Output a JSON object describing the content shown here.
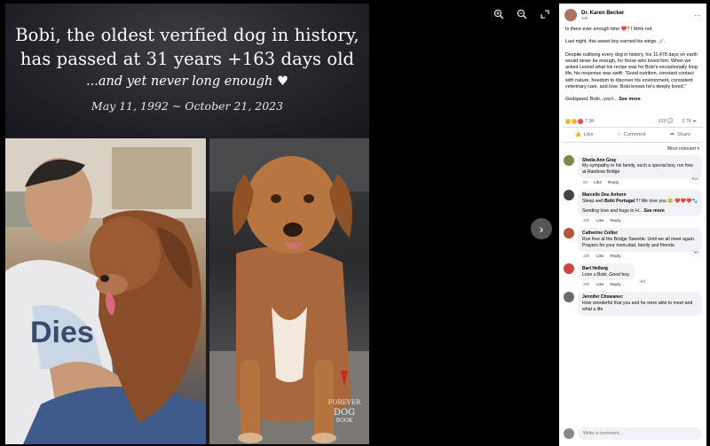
{
  "poster": {
    "title_line1": "Bobi, the oldest verified dog in history,",
    "title_line2": "has passed at 31 years +163 days old",
    "tagline": "...and yet never long enough ♥",
    "dates": "May 11, 1992 ~ October 21, 2023",
    "logo_text": "FOREVER DOG BOOK"
  },
  "viewer": {
    "zoom_in_icon": "zoom-in-icon",
    "zoom_out_icon": "zoom-out-icon",
    "fullscreen_icon": "expand-icon",
    "next_icon": "chevron-right-icon"
  },
  "post": {
    "author": "Dr. Karen Becker",
    "time": "10h ·",
    "p1": "Is there ever enough time ❤️? I think not.",
    "p2": "Last night, this sweet boy earned his wings 🪽.",
    "p3": "Despite outliving every dog in history, his 11,478 days on earth would never be enough, for those who loved him. When we asked Leonel what his recipe was for Bobi's exceptionally long life, his response was swift: \"Good nutrition, constant contact with nature, freedom to discover his environment, consistent veterinary care, and love. Bobi knows he's deeply loved.\"",
    "p4": "Godspeed, Bobi...you'r...",
    "see_more": "See more",
    "reactions_count": "7.3K",
    "comments_count": "610",
    "shares_count": "2.7K",
    "like_label": "Like",
    "comment_label": "Comment",
    "share_label": "Share",
    "sort_label": "Most relevant"
  },
  "comments": [
    {
      "name": "Sheila Ann Gray",
      "text": "My sympathy to his family, such a special boy, run free at Rainbow Bridge",
      "time": "6h",
      "like": "Like",
      "reply": "Reply",
      "reacts": "11",
      "avatar_color": "#7a8a4a"
    },
    {
      "name": "Marcelle Dee Anhorn",
      "text1": "Sleep well",
      "text_bold": "Bobi Portugal",
      "text2": "!!! We love you",
      "emoji": "😢 ❤️❤️❤️🐾",
      "text3": "Sending love and hugs to H...",
      "see_more": "See more",
      "time": "10h",
      "like": "Like",
      "reply": "Reply",
      "avatar_color": "#444"
    },
    {
      "name": "Catherine Collier",
      "text": "Run free at the Bridge Sweetie. Until we all meet again. Prayers for your mom,dad, family and friends.",
      "time": "10h",
      "like": "Like",
      "reply": "Reply",
      "reacts": "5",
      "avatar_color": "#b0553b"
    },
    {
      "name": "Bart Hellwig",
      "text": "Love u Bobi. Good boy.",
      "time": "10h",
      "like": "Like",
      "reply": "Reply",
      "reacts": "3",
      "avatar_color": "#c44"
    },
    {
      "name": "Jennifer Chowanec",
      "text": "How wonderful that you and he were able to meet and what a life",
      "time": "",
      "like": "",
      "reply": "",
      "avatar_color": "#6b6b6b"
    }
  ],
  "composer": {
    "placeholder": "Write a comment..."
  }
}
